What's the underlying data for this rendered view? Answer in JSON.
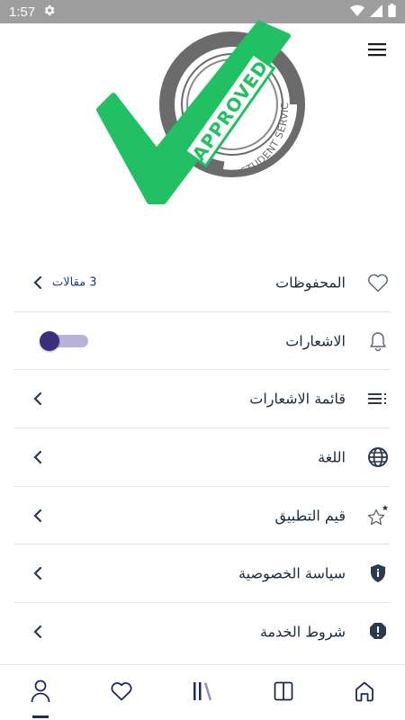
{
  "status_bar": {
    "time": "1:57",
    "icons": [
      "settings-icon",
      "wifi-icon",
      "cellular-icon",
      "battery-icon"
    ]
  },
  "header": {
    "menu_icon": "hamburger-menu-icon"
  },
  "logo": {
    "text_approved": "APPROVED",
    "text_services": "STUDENT SERVICES",
    "check_color": "#21c063",
    "ring_color": "#6b6b6b"
  },
  "settings": {
    "saved": {
      "label": "المحفوظات",
      "count": "3 مقالات",
      "icon": "heart-outline-icon"
    },
    "notifications": {
      "label": "الاشعارات",
      "icon": "bell-outline-icon",
      "toggle_on": true
    },
    "notification_list": {
      "label": "قائمة الاشعارات",
      "icon": "list-icon"
    },
    "language": {
      "label": "اللغة",
      "icon": "globe-icon"
    },
    "rate_app": {
      "label": "قيم التطبيق",
      "icon": "star-outline-icon"
    },
    "privacy": {
      "label": "سياسة الخصوصية",
      "icon": "shield-icon"
    },
    "terms": {
      "label": "شروط الخدمة",
      "icon": "alert-shield-icon"
    }
  },
  "bottom_nav": {
    "items": [
      "profile-icon",
      "heart-icon",
      "library-icon",
      "columns-icon",
      "home-icon"
    ],
    "active": "profile-icon",
    "accent_color": "#1f2a5a"
  }
}
